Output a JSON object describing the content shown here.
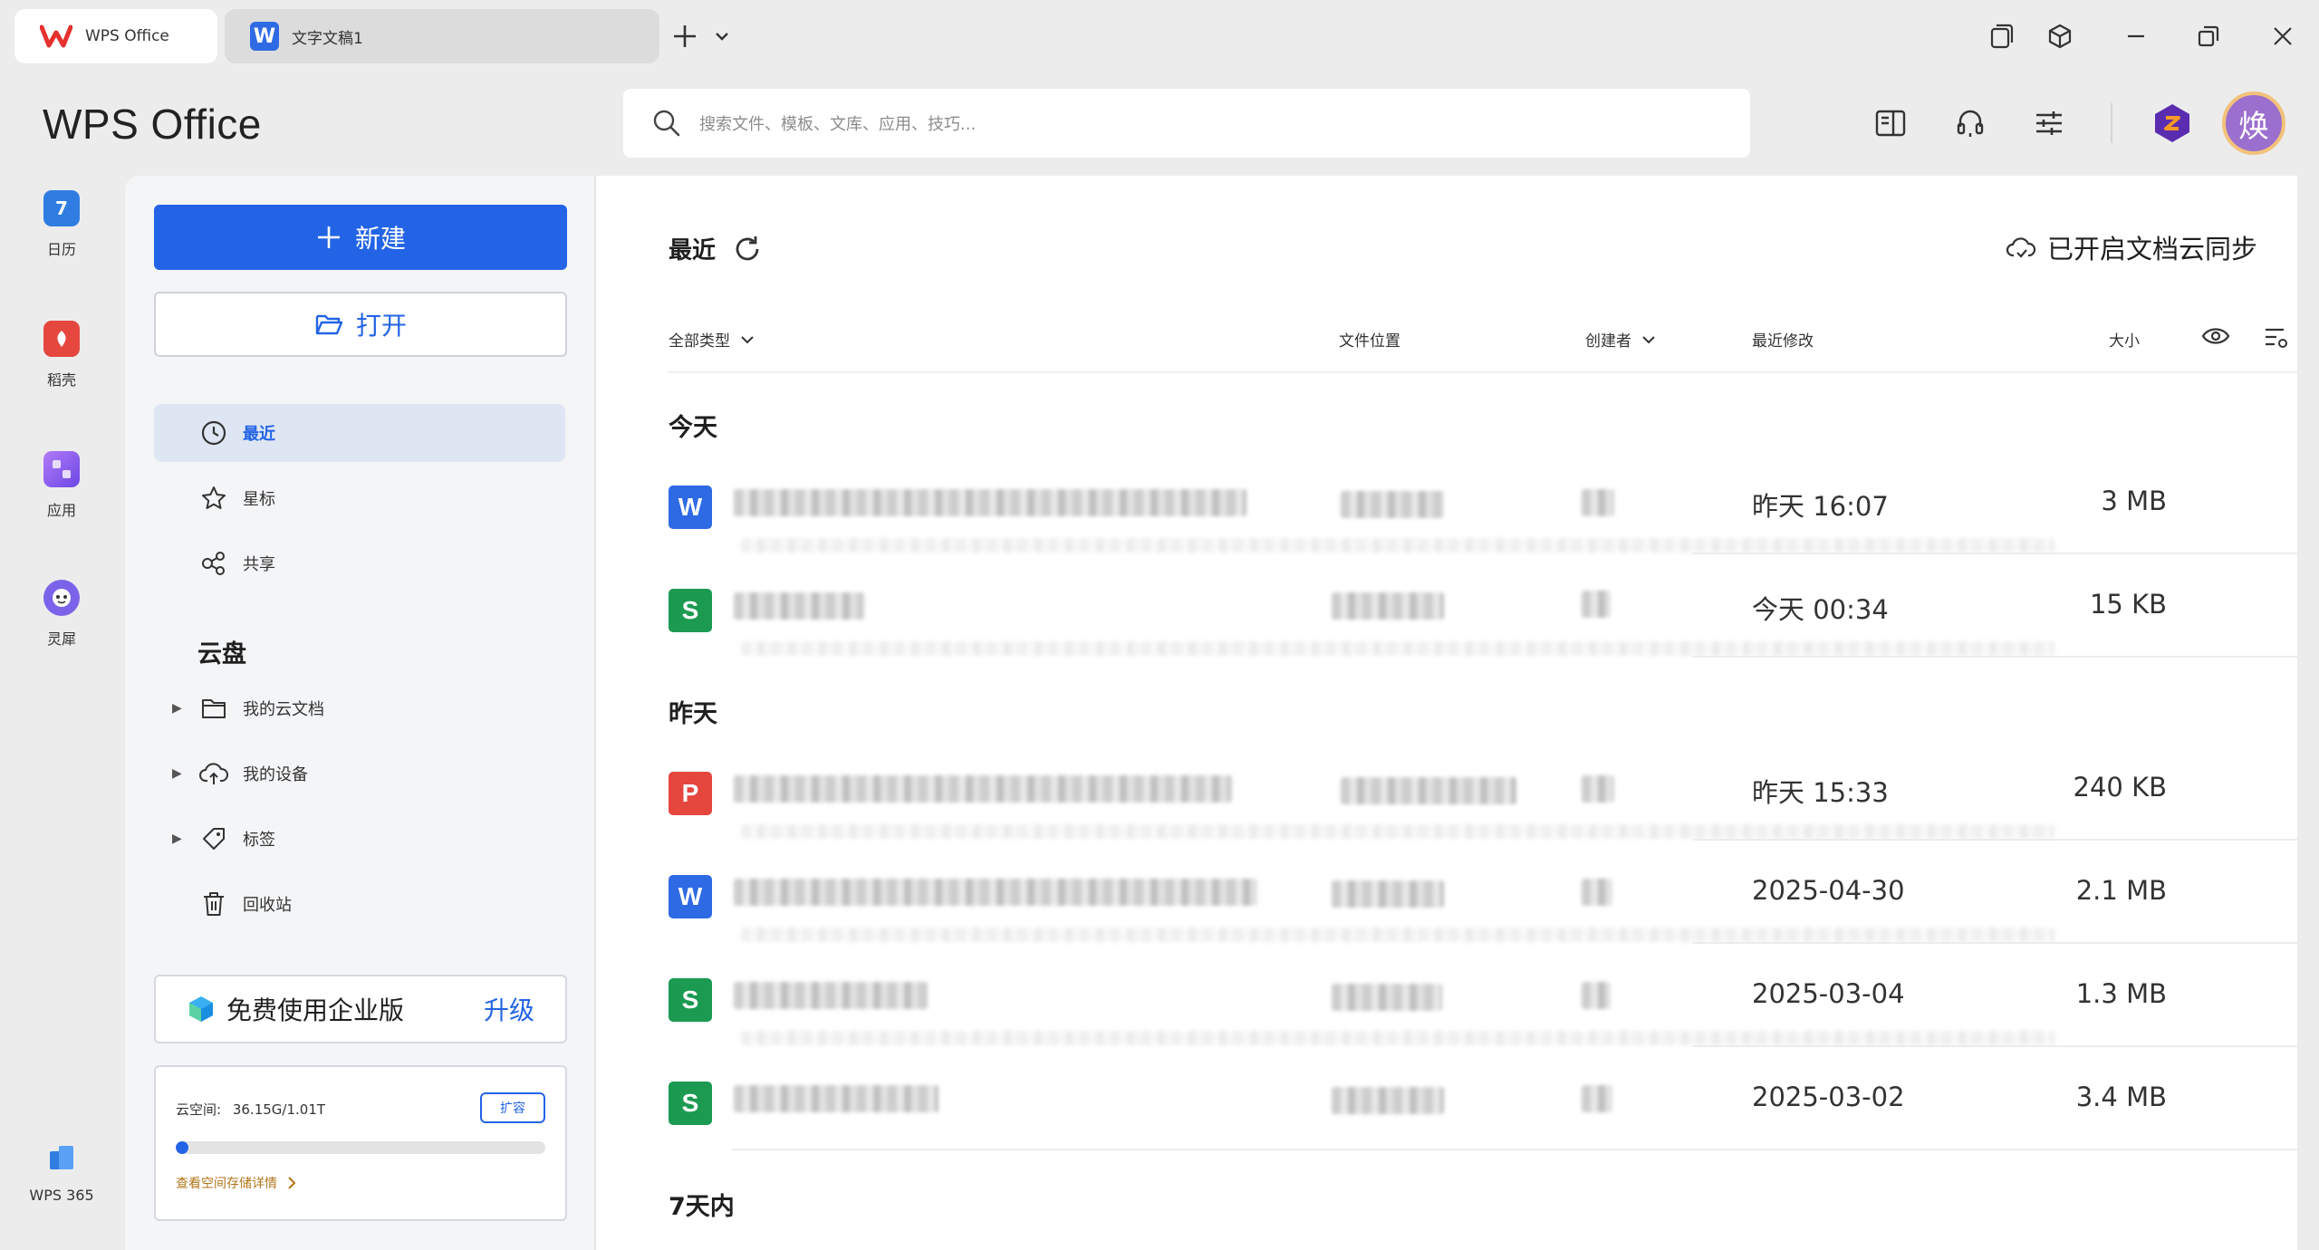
{
  "tabs": [
    {
      "label": "WPS Office"
    },
    {
      "label": "文字文稿1"
    }
  ],
  "header": {
    "brand": "WPS Office",
    "search_placeholder": "搜索文件、模板、文库、应用、技巧...",
    "avatar_char": "焕"
  },
  "rail": [
    {
      "label": "日历",
      "icon": "calendar-icon",
      "badge": "7",
      "color": "#2f7de1"
    },
    {
      "label": "稻壳",
      "icon": "docer-icon",
      "color": "#e5473f"
    },
    {
      "label": "应用",
      "icon": "apps-icon",
      "color": "#8a5cf0"
    },
    {
      "label": "灵犀",
      "icon": "lingxi-ai-icon",
      "color": "#7b63e9"
    },
    {
      "label": "WPS 365",
      "icon": "wps365-icon",
      "color": "#2f7de1"
    }
  ],
  "sidebar": {
    "new_label": "新建",
    "open_label": "打开",
    "nav": [
      {
        "label": "最近",
        "icon": "clock-icon",
        "active": true
      },
      {
        "label": "星标",
        "icon": "star-icon"
      },
      {
        "label": "共享",
        "icon": "share-icon"
      }
    ],
    "cloud_title": "云盘",
    "tree": [
      {
        "label": "我的云文档",
        "icon": "folder-icon"
      },
      {
        "label": "我的设备",
        "icon": "cloud-upload-icon"
      },
      {
        "label": "标签",
        "icon": "tag-icon"
      },
      {
        "label": "回收站",
        "icon": "trash-icon"
      }
    ],
    "promo_text": "免费使用企业版",
    "promo_link": "升级",
    "storage_label": "云空间:",
    "storage_value": "36.15G/1.01T",
    "storage_used_fraction": 0.035,
    "expand_label": "扩容",
    "storage_link": "查看空间存储详情"
  },
  "main": {
    "title": "最近",
    "cloud_sync": "已开启文档云同步",
    "columns": {
      "type": "全部类型",
      "location": "文件位置",
      "creator": "创建者",
      "modified": "最近修改",
      "size": "大小"
    },
    "groups": [
      {
        "title": "今天",
        "files": [
          {
            "type": "W",
            "color": "#2f6ae5",
            "modified": "昨天 16:07",
            "size": "3 MB"
          },
          {
            "type": "S",
            "color": "#1c9a52",
            "modified": "今天 00:34",
            "size": "15 KB"
          }
        ]
      },
      {
        "title": "昨天",
        "files": [
          {
            "type": "P",
            "color": "#e5473f",
            "modified": "昨天 15:33",
            "size": "240 KB"
          },
          {
            "type": "W",
            "color": "#2f6ae5",
            "modified": "2025-04-30",
            "size": "2.1 MB"
          },
          {
            "type": "S",
            "color": "#1c9a52",
            "modified": "2025-03-04",
            "size": "1.3 MB"
          },
          {
            "type": "S",
            "color": "#1c9a52",
            "modified": "2025-03-02",
            "size": "3.4 MB"
          }
        ]
      },
      {
        "title": "7天内",
        "files": []
      }
    ]
  }
}
